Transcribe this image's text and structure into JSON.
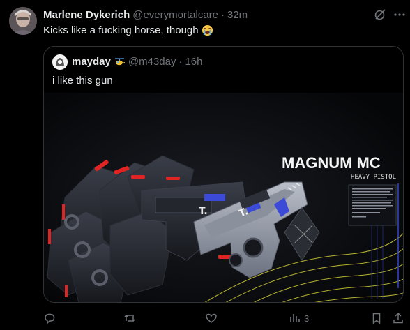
{
  "tweet": {
    "display_name": "Marlene Dykerich",
    "handle": "@everymortalcare",
    "separator": "·",
    "time": "32m",
    "text": "Kicks like a fucking horse, though",
    "emoji": "loudly-crying-face"
  },
  "quote": {
    "display_name": "mayday",
    "badge_icon": "helicopter-icon",
    "handle": "@m43day",
    "separator": "·",
    "time": "16h",
    "text": "i like this gun",
    "media": {
      "title": "MAGNUM MC",
      "subtitle": "HEAVY PISTOL"
    }
  },
  "actions": {
    "views_count": "3",
    "icons": [
      "reply-icon",
      "retweet-icon",
      "like-icon",
      "views-icon",
      "bookmark-icon",
      "share-icon"
    ]
  },
  "colors": {
    "background": "#000000",
    "text": "#e7e9ea",
    "muted": "#71767b",
    "border": "#2f3336",
    "accent_red": "#e02424",
    "accent_blue": "#3b4bd8",
    "contour_yellow": "#d8d23a"
  }
}
